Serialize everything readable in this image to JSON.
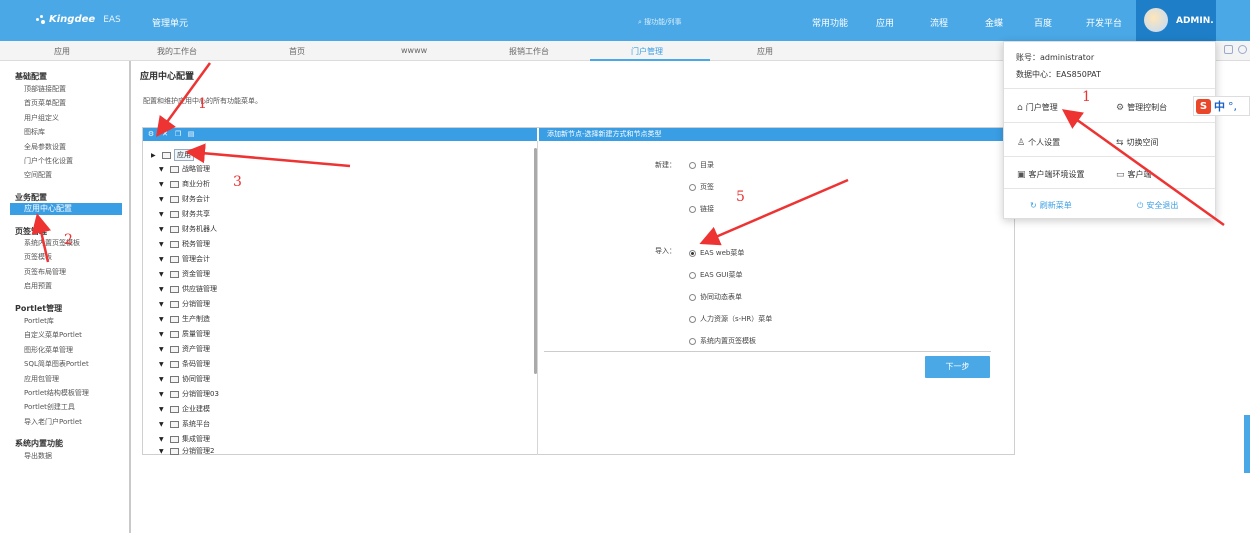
{
  "header": {
    "logo_text": "Kingdee",
    "logo_sub": "EAS",
    "unit": "管理单元",
    "search_placeholder": "搜功能/列事",
    "nav": [
      "常用功能",
      "应用",
      "流程",
      "金蝶",
      "百度",
      "开发平台"
    ],
    "user": "ADMIN."
  },
  "tabs": [
    "应用",
    "我的工作台",
    "首页",
    "wwww",
    "报销工作台",
    "门户管理",
    "应用"
  ],
  "active_tab": "门户管理",
  "sidebar": {
    "groups": [
      {
        "title": "基础配置",
        "items": [
          "顶部链接配置",
          "首页菜单配置",
          "用户组定义",
          "图标库",
          "全局参数设置",
          "门户个性化设置",
          "空间配置"
        ]
      },
      {
        "title": "业务配置",
        "items": [
          "应用中心配置"
        ]
      },
      {
        "title": "页签管理",
        "items": [
          "系统内置页签模板",
          "页签模板",
          "页签布局管理",
          "启用预置"
        ]
      },
      {
        "title": "Portlet管理",
        "items": [
          "Portlet库",
          "自定义菜单Portlet",
          "图形化菜单管理",
          "SQL简单图表Portlet",
          "应用包管理",
          "Portlet结构模板管理",
          "Portlet创建工具",
          "导入老门户Portlet"
        ]
      },
      {
        "title": "系统内置功能",
        "items": [
          "导出数据"
        ]
      }
    ],
    "selected": "应用中心配置"
  },
  "page": {
    "title": "应用中心配置",
    "description": "配置和维护应用中心的所有功能菜单。"
  },
  "toolbar_icons": [
    "gear-icon",
    "delete-icon",
    "copy-icon",
    "edit-icon"
  ],
  "tree": {
    "root": "应用",
    "children": [
      "战略管理",
      "商业分析",
      "财务会计",
      "财务共享",
      "财务机器人",
      "税务管理",
      "管理会计",
      "资金管理",
      "供应链管理",
      "分销管理",
      "生产制造",
      "质量管理",
      "资产管理",
      "条码管理",
      "协同管理",
      "分销管理03",
      "企业建模",
      "系统平台",
      "集成管理",
      "分销管理2"
    ]
  },
  "form": {
    "header": "添加新节点-选择新建方式和节点类型",
    "new_label": "新建：",
    "new_options": [
      "目录",
      "页签",
      "链接"
    ],
    "import_label": "导入：",
    "import_options": [
      "EAS web菜单",
      "EAS GUI菜单",
      "协同动态表单",
      "人力资源（s-HR）菜单",
      "系统内置页签模板"
    ],
    "import_selected_index": 0,
    "next_button": "下一步"
  },
  "dropdown": {
    "account": "账号：administrator",
    "datacenter": "数据中心：EAS850PAT",
    "items": [
      "门户管理",
      "管理控制台",
      "个人设置",
      "切换空间",
      "客户端环境设置",
      "客户端"
    ],
    "refresh": "刷新菜单",
    "logout": "安全退出"
  },
  "ime": {
    "zh": "中"
  },
  "annotations": [
    "1",
    "2",
    "3",
    "1",
    "5"
  ]
}
